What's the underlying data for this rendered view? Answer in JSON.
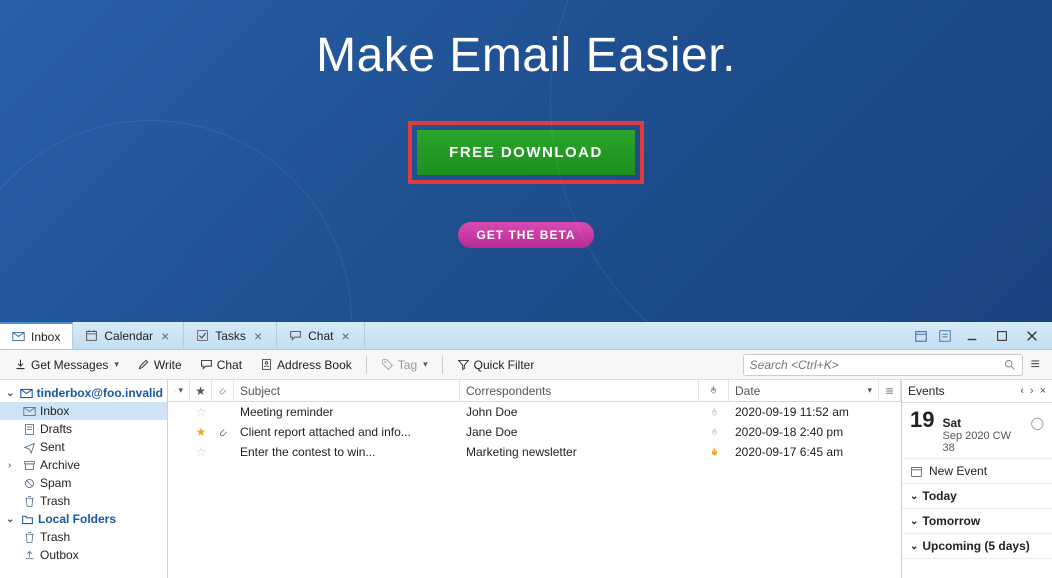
{
  "hero": {
    "title": "Make Email Easier.",
    "download_label": "FREE DOWNLOAD",
    "beta_label": "GET THE BETA"
  },
  "tabs": [
    {
      "label": "Inbox",
      "icon": "mail-icon",
      "closable": false,
      "active": true
    },
    {
      "label": "Calendar",
      "icon": "calendar-icon",
      "closable": true
    },
    {
      "label": "Tasks",
      "icon": "tasks-icon",
      "closable": true
    },
    {
      "label": "Chat",
      "icon": "chat-icon",
      "closable": true
    }
  ],
  "toolbar": {
    "get_messages": "Get Messages",
    "write": "Write",
    "chat": "Chat",
    "address_book": "Address Book",
    "tag": "Tag",
    "quick_filter": "Quick Filter",
    "search_placeholder": "Search <Ctrl+K>"
  },
  "folders": {
    "account": "tinderbox@foo.invalid",
    "items1": [
      "Inbox",
      "Drafts",
      "Sent",
      "Archive",
      "Spam",
      "Trash"
    ],
    "local_label": "Local Folders",
    "items2": [
      "Trash",
      "Outbox"
    ]
  },
  "columns": {
    "subject": "Subject",
    "correspondents": "Correspondents",
    "date": "Date"
  },
  "messages": [
    {
      "star": false,
      "attach": false,
      "subject": "Meeting reminder",
      "corr": "John Doe",
      "fire": false,
      "date": "2020-09-19 11:52 am"
    },
    {
      "star": true,
      "attach": true,
      "subject": "Client report attached and info...",
      "corr": "Jane Doe",
      "fire": false,
      "date": "2020-09-18 2:40 pm"
    },
    {
      "star": false,
      "attach": false,
      "subject": "Enter the contest to win...",
      "corr": "Marketing newsletter",
      "fire": true,
      "date": "2020-09-17 6:45 am"
    }
  ],
  "calendar": {
    "title": "Events",
    "big_date": "19",
    "day": "Sat",
    "sub": "Sep 2020 CW 38",
    "new_event": "New Event",
    "sections": [
      "Today",
      "Tomorrow",
      "Upcoming (5 days)"
    ]
  }
}
